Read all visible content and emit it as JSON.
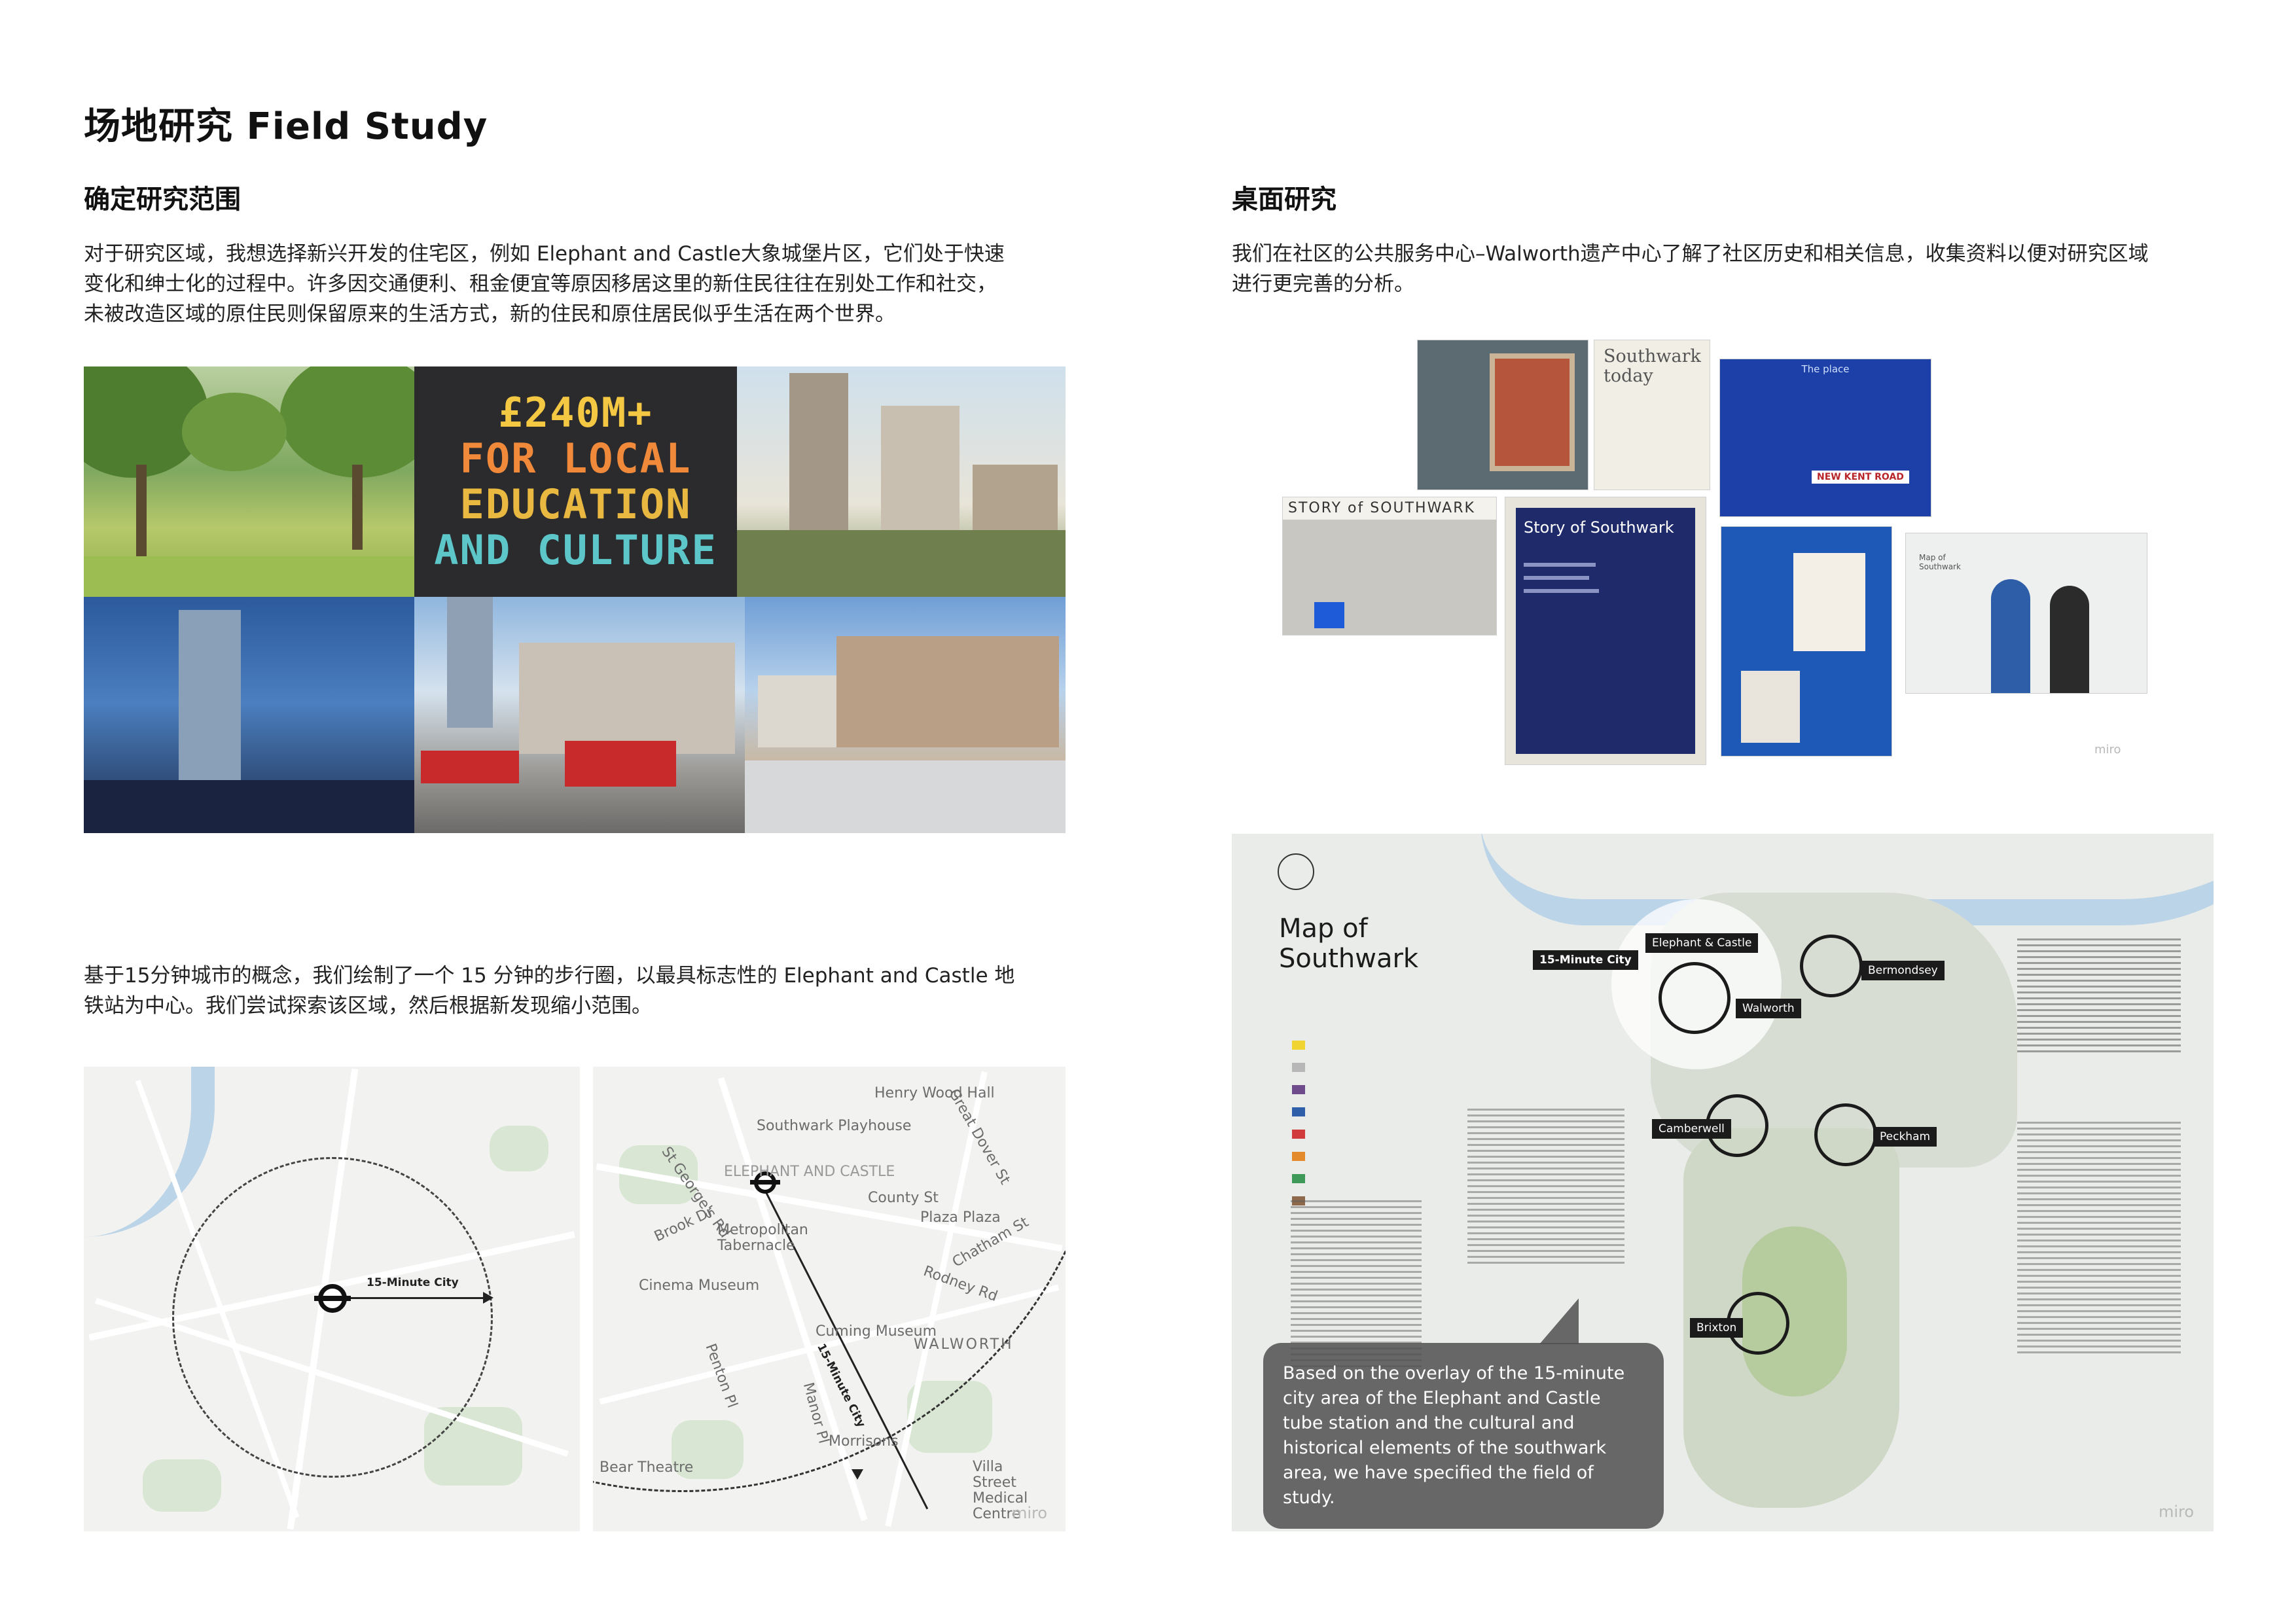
{
  "page": {
    "title": "场地研究 Field Study"
  },
  "left": {
    "section_title": "确定研究范围",
    "intro": [
      "对于研究区域，我想选择新兴开发的住宅区，例如 Elephant and Castle大象城堡片区，它们处于快速",
      "变化和绅士化的过程中。许多因交通便利、租金便宜等原因移居这里的新住民往往在别处工作和社交，",
      "未被改造区域的原住民则保留原来的生活方式，新的住民和原住居民似乎生活在两个世界。"
    ],
    "poster_lines": [
      "£240M+",
      "FOR LOCAL",
      "EDUCATION",
      "AND CULTURE"
    ],
    "walk_intro": [
      "基于15分钟城市的概念，我们绘制了一个 15 分钟的步行圈，以最具标志性的 Elephant and Castle 地",
      "铁站为中心。我们尝试探索该区域，然后根据新发现缩小范围。"
    ],
    "map1": {
      "radius_label": "15-Minute City"
    },
    "map2": {
      "route_label": "15-Minute City",
      "places": [
        "Henry Wood Hall",
        "Southwark Playhouse",
        "ELEPHANT AND CASTLE",
        "Metropolitan Tabernacle",
        "Cinema Museum",
        "Cuming Museum",
        "Plaza Plaza",
        "County St",
        "WALWORTH",
        "Villa Street Medical Centre",
        "Morrisons",
        "Bear Theatre",
        "St George's Rd",
        "Great Dover St",
        "Rodney Rd",
        "Brook Dr",
        "Penton Pl",
        "Manor Pl",
        "Chatham St"
      ],
      "watermark": "miro"
    }
  },
  "right": {
    "section_title": "桌面研究",
    "intro": [
      "我们在社区的公共服务中心–Walworth遗产中心了解了社区历史和相关信息，收集资料以便对研究区域",
      "进行更完善的分析。"
    ],
    "photos": {
      "southwark_today": "Southwark today",
      "the_place": "The place",
      "new_kent_road": "NEW KENT ROAD",
      "story_banner": "STORY of SOUTHWARK",
      "story_panel_title": "Story of Southwark",
      "map_mini": "Map of Southwark",
      "watermark": "miro"
    },
    "big_map": {
      "title_line1": "Map of",
      "title_line2": "Southwark",
      "city_tag": "15-Minute City",
      "areas": [
        "Elephant & Castle",
        "Walworth",
        "Bermondsey",
        "Camberwell",
        "Peckham",
        "Brixton"
      ],
      "callout": "Based on the overlay of the 15-minute city area of the Elephant and Castle tube station and the cultural and historical elements of the southwark area, we have specified the field of study.",
      "watermark": "miro"
    }
  },
  "colors": {
    "navy": "#1f2a6b",
    "poster_bg": "#2b2b2e",
    "callout_bg": "#505050",
    "map_bg": "#f2f3f1",
    "river": "#bcd4e8"
  }
}
